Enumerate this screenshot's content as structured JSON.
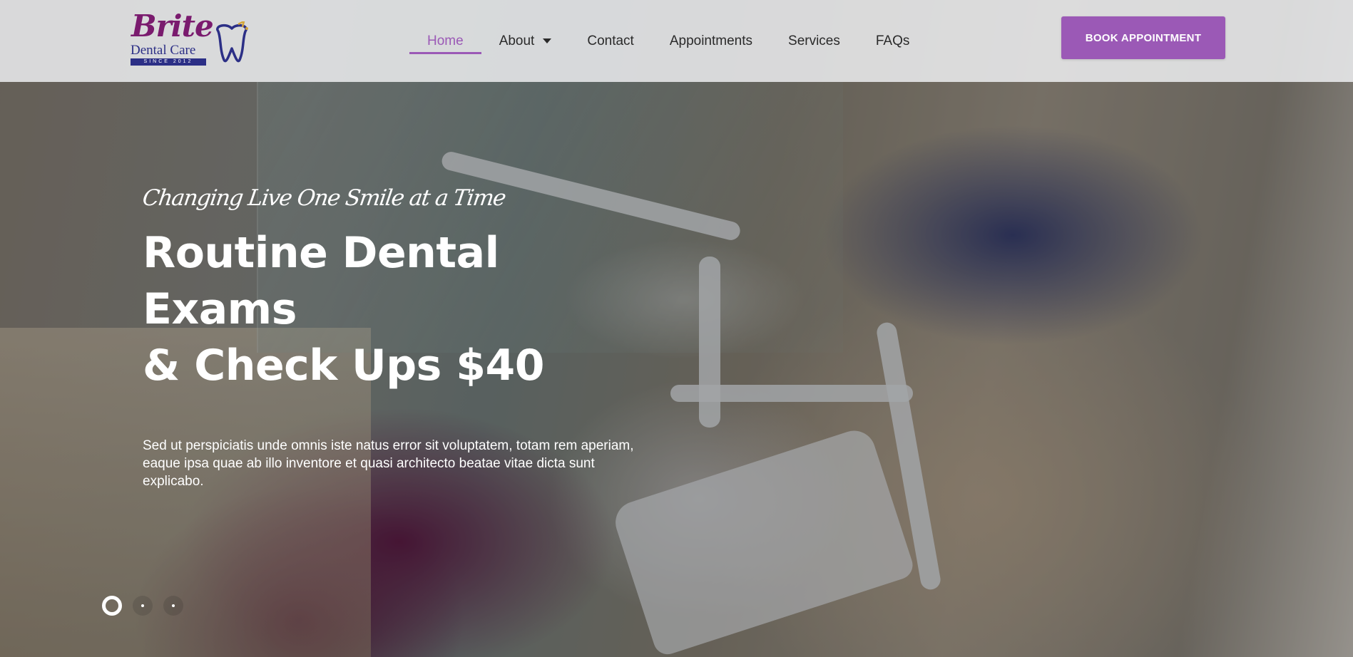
{
  "brand": {
    "name": "Brite",
    "subtitle": "Dental Care",
    "since": "SINCE 2012",
    "logo_colors": {
      "script": "#7a1b6e",
      "text": "#2c2f86",
      "tooth_gold": "#d4a63a"
    }
  },
  "nav": {
    "items": [
      {
        "label": "Home",
        "active": true
      },
      {
        "label": "About",
        "has_dropdown": true
      },
      {
        "label": "Contact"
      },
      {
        "label": "Appointments"
      },
      {
        "label": "Services"
      },
      {
        "label": "FAQs"
      }
    ],
    "cta_label": "BOOK APPOINTMENT"
  },
  "hero": {
    "tagline": "Changing Live One Smile at a Time",
    "headline_line1": "Routine Dental Exams",
    "headline_line2": "& Check Ups $40",
    "description": "Sed ut perspiciatis unde omnis iste natus error sit voluptatem, totam rem aperiam, eaque ipsa quae ab illo inventore et quasi architecto beatae vitae dicta sunt explicabo."
  },
  "slider": {
    "count": 3,
    "active_index": 0
  },
  "colors": {
    "accent": "#9b59b6",
    "header_bg": "#f0f1f3",
    "nav_text": "#2a2a2a"
  }
}
